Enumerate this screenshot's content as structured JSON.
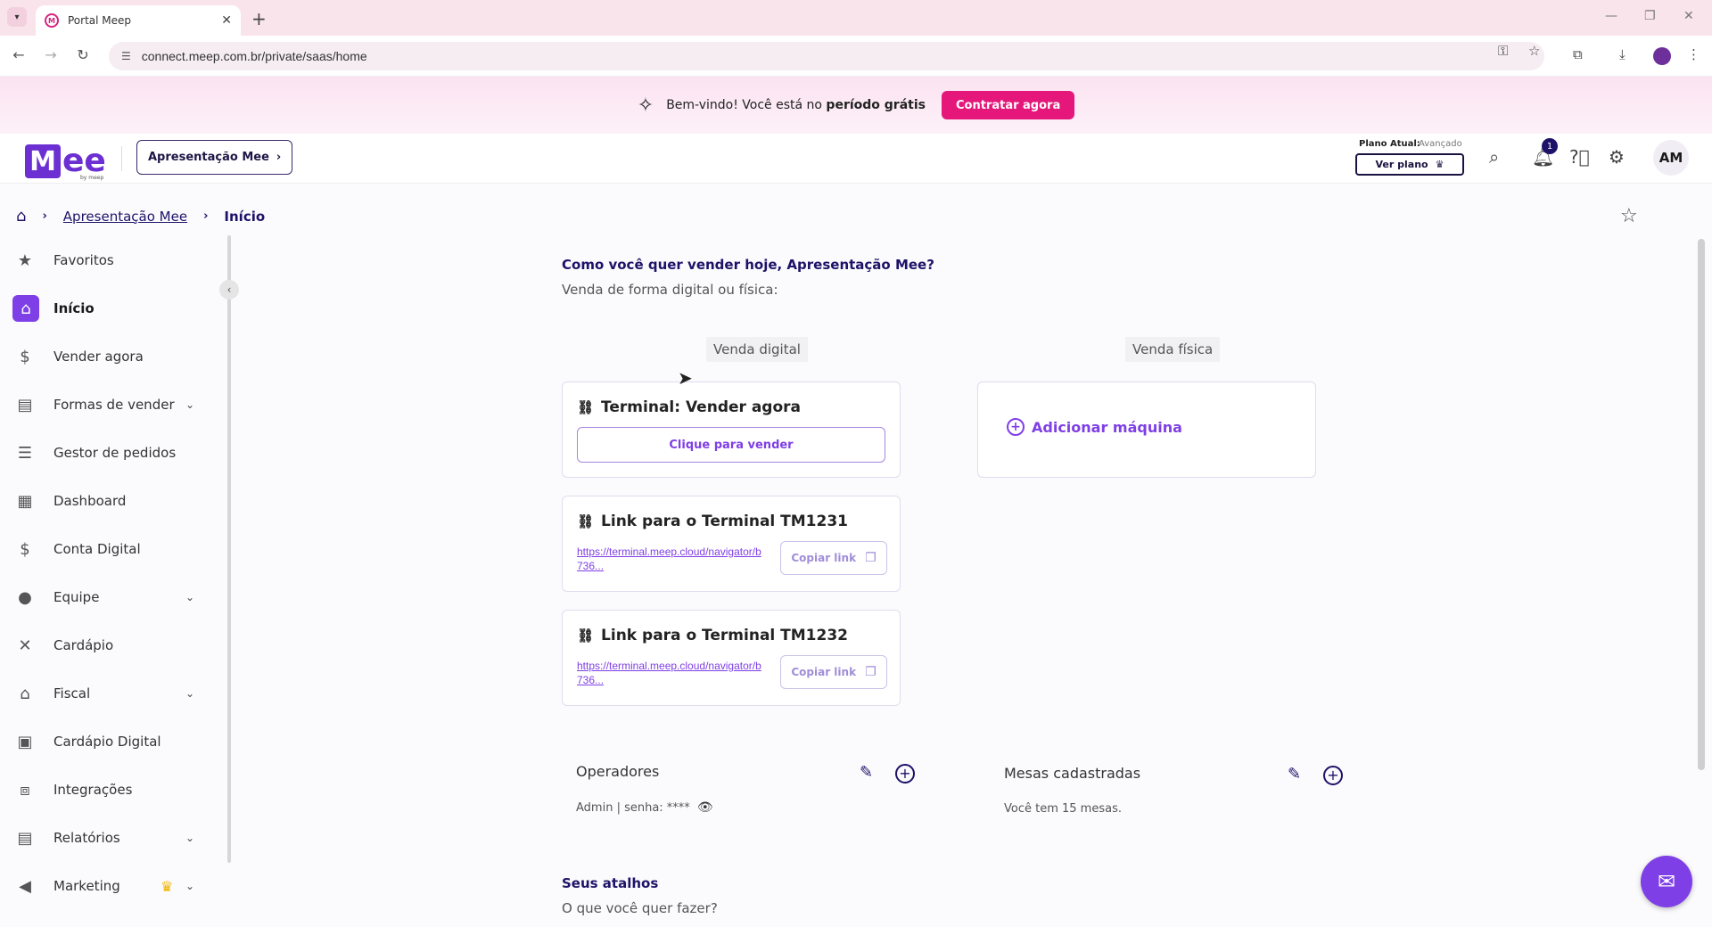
{
  "browser": {
    "tab_title": "Portal Meep",
    "url": "connect.meep.com.br/private/saas/home"
  },
  "banner": {
    "text_prefix": "Bem-vindo! Você está no ",
    "text_bold": "período grátis",
    "cta": "Contratar agora"
  },
  "header": {
    "logo_text": "ee",
    "logo_sub": "by meep",
    "store": "Apresentação Mee",
    "plan_label": "Plano Atual:",
    "plan_value": "Avançado",
    "plan_button": "Ver plano",
    "notifications": "1",
    "avatar": "AM"
  },
  "breadcrumb": {
    "link": "Apresentação Mee",
    "current": "Início"
  },
  "sidebar": {
    "items": [
      {
        "label": "Favoritos",
        "icon": "star-icon"
      },
      {
        "label": "Início",
        "icon": "home-icon",
        "active": true
      },
      {
        "label": "Vender agora",
        "icon": "dollar-icon"
      },
      {
        "label": "Formas de vender",
        "icon": "register-icon",
        "expandable": true
      },
      {
        "label": "Gestor de pedidos",
        "icon": "list-icon"
      },
      {
        "label": "Dashboard",
        "icon": "dashboard-icon"
      },
      {
        "label": "Conta Digital",
        "icon": "dollar-icon"
      },
      {
        "label": "Equipe",
        "icon": "person-icon",
        "expandable": true
      },
      {
        "label": "Cardápio",
        "icon": "utensils-icon"
      },
      {
        "label": "Fiscal",
        "icon": "bank-icon",
        "expandable": true
      },
      {
        "label": "Cardápio Digital",
        "icon": "qr-icon"
      },
      {
        "label": "Integrações",
        "icon": "integration-icon"
      },
      {
        "label": "Relatórios",
        "icon": "report-icon",
        "expandable": true
      },
      {
        "label": "Marketing",
        "icon": "megaphone-icon",
        "expandable": true,
        "premium": true
      }
    ]
  },
  "main": {
    "title": "Como você quer vender hoje, Apresentação Mee?",
    "subtitle": "Venda de forma digital ou física:",
    "digital_label": "Venda digital",
    "physical_label": "Venda física",
    "terminal_card": {
      "title": "Terminal: Vender agora",
      "button": "Clique para vender"
    },
    "link_cards": [
      {
        "title": "Link para o Terminal TM1231",
        "link": "https://terminal.meep.cloud/navigator/b736...",
        "button": "Copiar link"
      },
      {
        "title": "Link para o Terminal TM1232",
        "link": "https://terminal.meep.cloud/navigator/b736...",
        "button": "Copiar link"
      }
    ],
    "add_machine": "Adicionar máquina",
    "operators": {
      "title": "Operadores",
      "text": "Admin | senha: ****"
    },
    "tables": {
      "title": "Mesas cadastradas",
      "text": "Você tem 15 mesas."
    },
    "shortcuts": {
      "title": "Seus atalhos",
      "subtitle": "O que você quer fazer?"
    }
  },
  "colors": {
    "accent": "#7f3fe6",
    "brand_pink": "#e5177b",
    "navy": "#1e1268"
  }
}
